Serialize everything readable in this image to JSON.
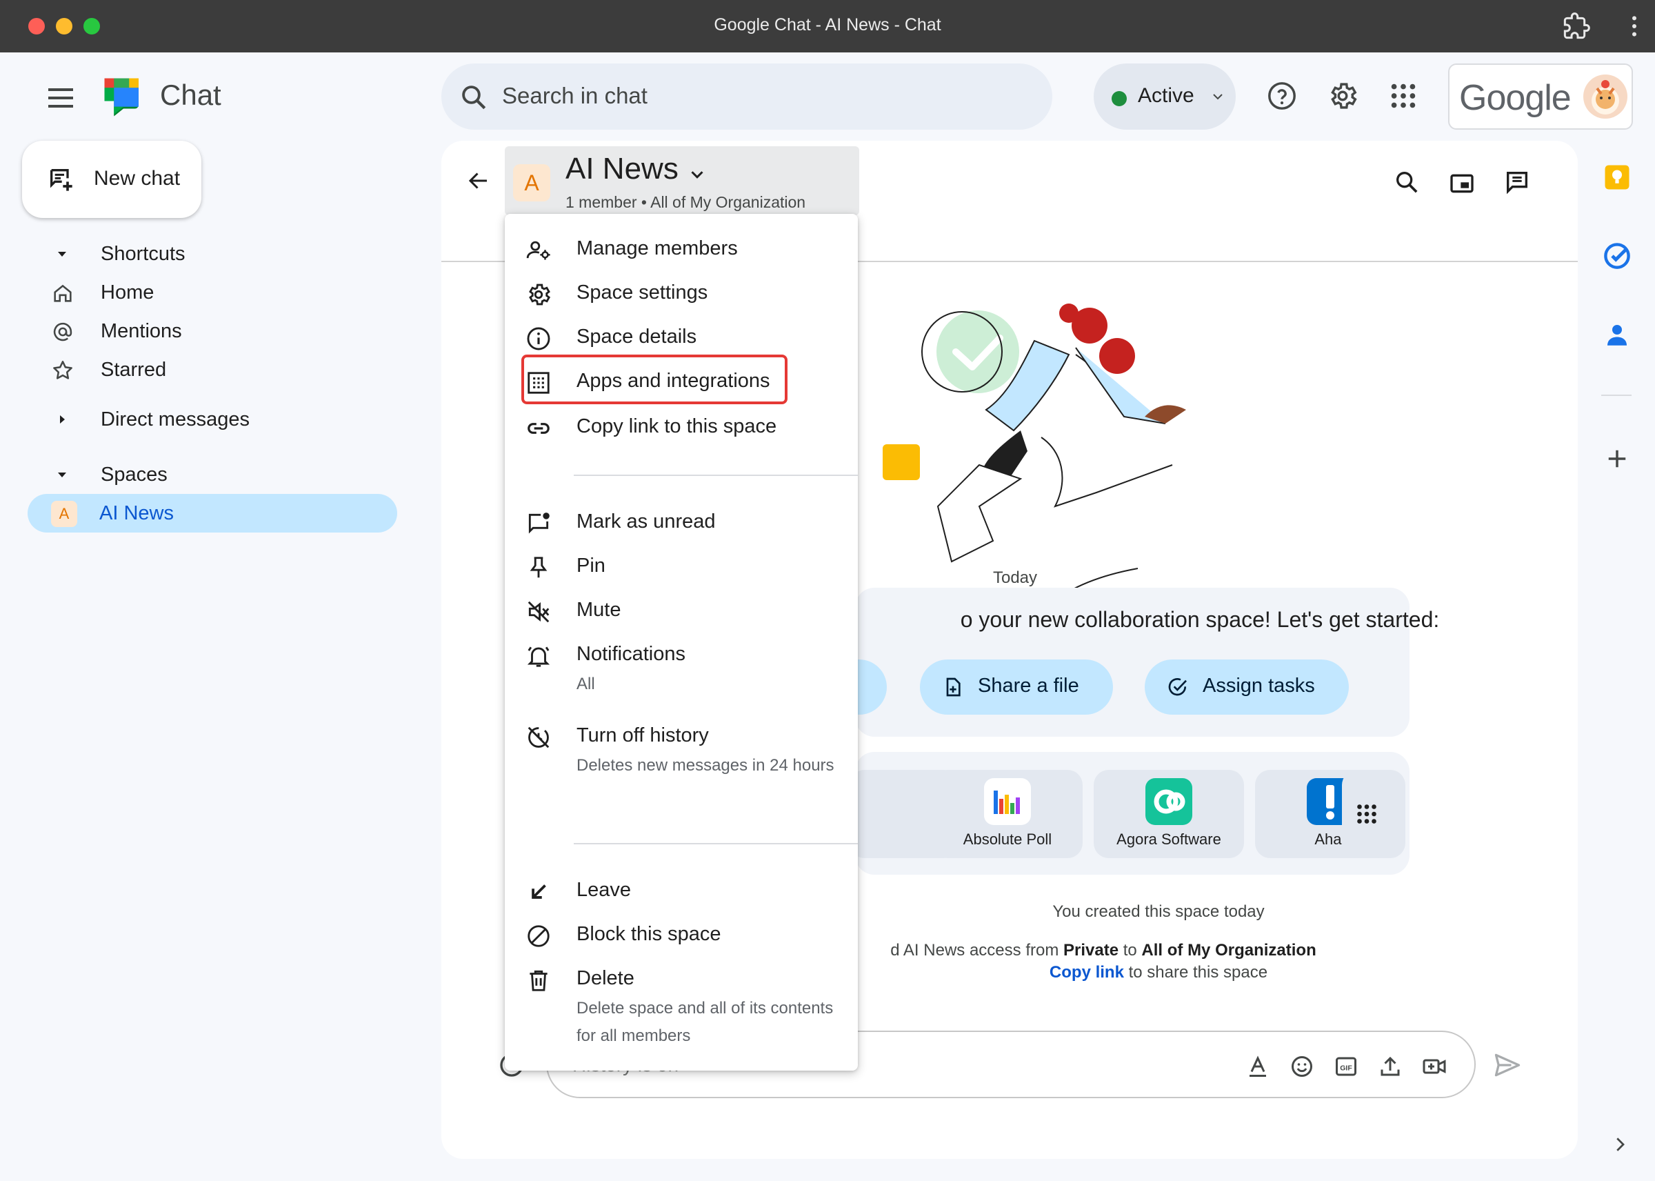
{
  "window": {
    "title": "Google Chat - AI News - Chat"
  },
  "app": {
    "brand": "Chat"
  },
  "search": {
    "placeholder": "Search in chat"
  },
  "status": {
    "label": "Active",
    "color": "#1e8e3e"
  },
  "account": {
    "wordmark": "Google"
  },
  "nav": {
    "new_chat": "New chat",
    "shortcuts": "Shortcuts",
    "items": [
      "Home",
      "Mentions",
      "Starred"
    ],
    "direct_messages": "Direct messages",
    "spaces": "Spaces",
    "space_items": [
      {
        "initial": "A",
        "label": "AI News"
      }
    ]
  },
  "space": {
    "initial": "A",
    "title": "AI News",
    "subtitle": "1 member  •  All of My Organization"
  },
  "menu": {
    "items": [
      {
        "label": "Manage members",
        "icon": "manage-members-icon"
      },
      {
        "label": "Space settings",
        "icon": "gear-icon"
      },
      {
        "label": "Space details",
        "icon": "info-icon"
      },
      {
        "label": "Apps and integrations",
        "icon": "apps-grid-icon",
        "highlighted": true
      },
      {
        "label": "Copy link to this space",
        "icon": "link-icon"
      },
      {
        "label": "Mark as unread",
        "icon": "mark-unread-icon"
      },
      {
        "label": "Pin",
        "icon": "pin-icon"
      },
      {
        "label": "Mute",
        "icon": "mute-icon"
      },
      {
        "label": "Notifications",
        "sub": "All",
        "icon": "bell-icon"
      },
      {
        "label": "Turn off history",
        "sub": "Deletes new messages in 24 hours",
        "icon": "history-off-icon"
      },
      {
        "label": "Leave",
        "icon": "leave-arrow-icon"
      },
      {
        "label": "Block this space",
        "icon": "block-icon"
      },
      {
        "label": "Delete",
        "sub": "Delete space and all of its contents for all members",
        "icon": "trash-icon"
      }
    ],
    "highlight_color": "#e53935"
  },
  "conversation": {
    "date": "Today",
    "welcome": "o your new collaboration space! Let's get started:",
    "actions": [
      "Share a file",
      "Assign tasks"
    ],
    "apps": [
      "Absolute Poll",
      "Agora Software",
      "Aha!"
    ],
    "created": "You created this space today",
    "changed_prefix": "d AI News access from ",
    "changed_from": "Private",
    "changed_mid": " to ",
    "changed_to": "All of My Organization",
    "copy_link": "Copy link",
    "copy_link_suffix": " to share this space"
  },
  "composer": {
    "placeholder": "History is on"
  },
  "colors": {
    "accent": "#0b57d0",
    "selected_bg": "#c2e7ff",
    "page_bg": "#f6f8fc"
  }
}
